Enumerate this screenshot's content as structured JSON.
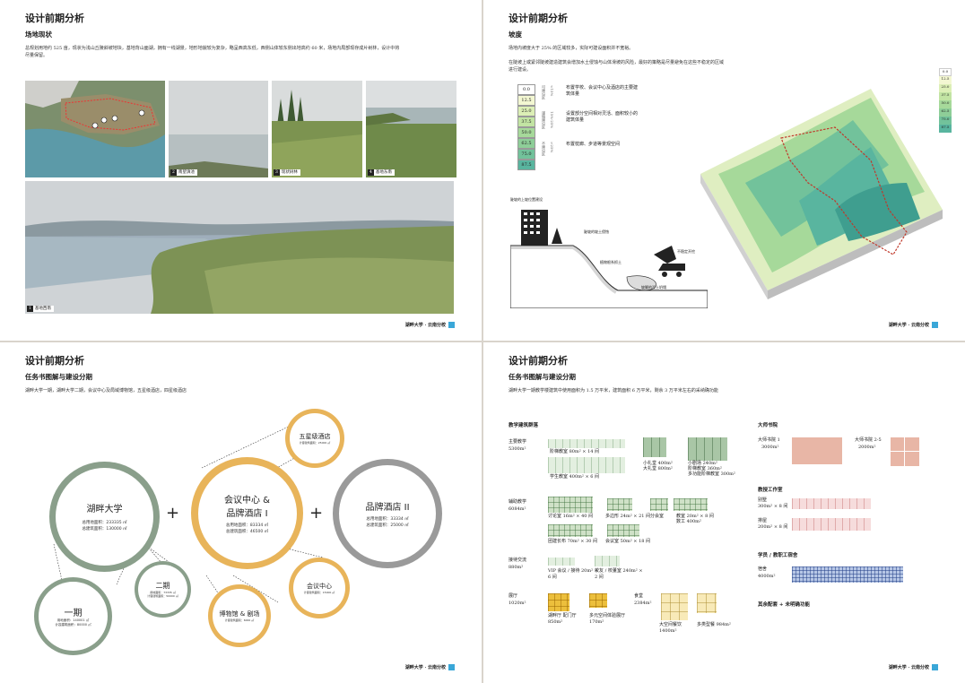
{
  "footer": "湖畔大学 · 云南分校",
  "page1": {
    "title": "设计前期分析",
    "subtitle": "场地现状",
    "desc": "总规划用地约 525 亩，现状为浅山丘陵斜坡地块，基地背山面湖，拥有一线湖景，地形地貌较为复杂，略呈西高东低，西侧山体较东侧出地高约 60 米，场地内局部现存成片树林，设计中将尽量保留。",
    "photos": [
      {
        "num": "1",
        "label": "基地西南"
      },
      {
        "num": "2",
        "label": "南望滇池"
      },
      {
        "num": "3",
        "label": "现状树林"
      },
      {
        "num": "4",
        "label": "基地东南"
      }
    ]
  },
  "page2": {
    "title": "设计前期分析",
    "subtitle": "坡度",
    "desc1": "场地内坡度大于 25% 的区域较多，实际可建设面积并不宽裕。",
    "desc2": "在陡坡上或紧邻陡坡建造建筑会增加水土侵蚀与山体滑坡的风险，最好的策略是尽量避免在这些不稳定的区域进行建设。",
    "legend": [
      "0.0",
      "12.5",
      "25.0",
      "37.5",
      "50.0",
      "62.5",
      "75.0",
      "87.5"
    ],
    "zones": [
      {
        "name": "可建设区",
        "range": "<15%",
        "text": "布置学校、会议中心及酒店的主要建筑体量"
      },
      {
        "name": "谨慎建设区",
        "range": "15%-25%",
        "text": "设置部分空间相对灵活、面积较小的建筑体量"
      },
      {
        "name": "不建设区",
        "range": ">25%",
        "text": "布置枕廊、步道等景观空间"
      }
    ],
    "map_legend": [
      "0.0",
      "12.5",
      "25.0",
      "37.5",
      "50.0",
      "62.5",
      "75.0",
      "87.5"
    ],
    "section_labels": [
      "陡坡的上坡位置建设",
      "陡坡的坡土侵蚀",
      "植物根系抓土",
      "不稳定开挖",
      "坡脚的泥土坍塌"
    ]
  },
  "page3": {
    "title": "设计前期分析",
    "subtitle": "任务书图解与建设分期",
    "desc": "湖畔大学一期，湖畔大学二期，会议中心及局域博物馆，五星级酒店，四星级酒店",
    "circles": {
      "hupan": {
        "name": "湖畔大学",
        "l1": "总用地面积：233335 ㎡",
        "l2": "总建筑面积：130000 ㎡"
      },
      "conf_hotel": {
        "name1": "会议中心 &",
        "name2": "品牌酒店 I",
        "l1": "总用地面积：83334 ㎡",
        "l2": "总建筑面积：46500 ㎡"
      },
      "hotel2": {
        "name": "品牌酒店 II",
        "l1": "总用地面积：33334 ㎡",
        "l2": "总建筑面积：25000 ㎡"
      },
      "phase1": {
        "name": "一期",
        "l1": "用地面积：140001 ㎡",
        "l2": "计容建筑面积：80000 ㎡"
      },
      "phase2": {
        "name": "二期",
        "l1": "用地面积：73335 ㎡",
        "l2": "计容建筑面积：50000 ㎡"
      },
      "fivestar": {
        "name": "五星级酒店",
        "l1": "计容建筑面积：25000 ㎡"
      },
      "conf": {
        "name": "会议中心",
        "l1": "计容建筑面积：15000 ㎡"
      },
      "museum": {
        "name": "博物馆 & 剧场",
        "l1": "计容建筑面积：6000 ㎡"
      }
    },
    "plus": "+"
  },
  "page4": {
    "title": "设计前期分析",
    "subtitle": "任务书图解与建设分期",
    "desc": "湖畔大学一期教学楼建筑中使用面积为 1.5 万平米，建筑面积 6 万平米，剩余 3 万平米左右的采纳确功能",
    "left_title": "教学建筑群落",
    "right_title": "大师书院",
    "groups": [
      {
        "name": "主要教学",
        "area": "5300m²",
        "items": [
          "阶梯教室 80m² × 14 间",
          "小礼堂 400m²",
          "大礼堂 800m²",
          "小剧场 240m²",
          "阶梯教室 360m²",
          "多功能阶梯教室 300m²",
          "学生教室 400m² × 6 间"
        ]
      },
      {
        "name": "辅助教学",
        "area": "6084m²",
        "items": [
          "讨论室 16m² × 40 间",
          "多边形 24m² × 21 间",
          "分会室",
          "教室 20m² × 8 间",
          "数工 400m²",
          "团建长布 70m² × 30 间",
          "会议室 50m² × 18 间"
        ]
      },
      {
        "name": "接待交流",
        "area": "880m²",
        "items": [
          "VIP 会议 / 接待 20m² × 6 间",
          "校友 / 校董室 240m² × 2 间"
        ]
      },
      {
        "name": "展厅",
        "area": "1020m²",
        "items": [
          "湖畔厅 配门厅 850m²",
          "多元空间体验展厅 170m²"
        ]
      },
      {
        "name": "食堂",
        "area": "2384m²",
        "items": [
          "大空间餐饮 1400m²",
          "多类型餐 984m²"
        ]
      }
    ],
    "right": {
      "master1": {
        "name": "大师书院 1",
        "area": "3000m²"
      },
      "master25": {
        "name": "大师书院 2-5",
        "area": "2000m²"
      },
      "prof_title": "教授工作室",
      "studio": {
        "name": "别墅",
        "detail": "300m² × 8 间"
      },
      "row": {
        "name": "排屋",
        "detail": "200m² × 8 间"
      },
      "dorm_title": "学员 / 教职工宿舍",
      "dorm": {
        "name": "宿舍",
        "area": "4000m²"
      },
      "other": "其余配套 + 未明确功能"
    }
  },
  "colors": {
    "green_ring": "#8a9f8b",
    "gold_ring": "#e8b45a",
    "grey_ring": "#9a9a9a",
    "footer_accent": "#3aa7d8"
  }
}
